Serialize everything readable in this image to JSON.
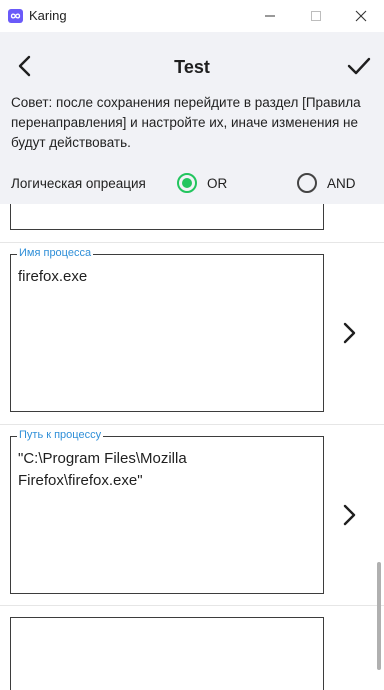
{
  "window": {
    "title": "Karing",
    "app_icon": "infinity-link-icon"
  },
  "header": {
    "title": "Test",
    "back_icon": "chevron-left-icon",
    "confirm_icon": "checkmark-icon"
  },
  "hint": "Совет: после сохранения перейдите в раздел [Правила перенаправления] и настройте их, иначе изменения не будут действовать.",
  "logic": {
    "label": "Логическая опреация",
    "options": [
      {
        "label": "OR",
        "selected": true
      },
      {
        "label": "AND",
        "selected": false
      }
    ],
    "accent_color": "#22c55e"
  },
  "fields": [
    {
      "legend": "Имя процесса",
      "value": "firefox.exe"
    },
    {
      "legend": "Путь к процессу",
      "value": "\"C:\\Program Files\\Mozilla Firefox\\firefox.exe\""
    }
  ],
  "colors": {
    "legend": "#2f8fd8",
    "header_bg": "#f1f2f6"
  }
}
